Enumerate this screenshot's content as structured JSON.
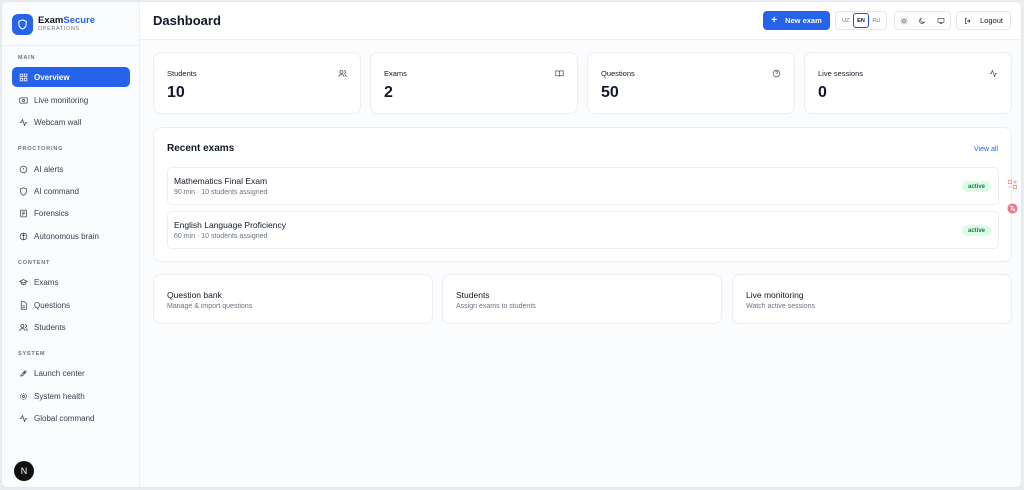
{
  "brand": {
    "name_a": "Exam",
    "name_b": "Secure",
    "subtitle": "OPERATIONS"
  },
  "sidebar": {
    "sections": [
      {
        "title": "MAIN",
        "items": [
          {
            "label": "Overview",
            "icon": "grid-icon",
            "active": true
          },
          {
            "label": "Live monitoring",
            "icon": "monitor-icon"
          },
          {
            "label": "Webcam wall",
            "icon": "activity-icon"
          }
        ]
      },
      {
        "title": "PROCTORING",
        "items": [
          {
            "label": "AI alerts",
            "icon": "alert-icon"
          },
          {
            "label": "AI command",
            "icon": "shield-icon"
          },
          {
            "label": "Forensics",
            "icon": "forensics-icon"
          },
          {
            "label": "Autonomous brain",
            "icon": "brain-icon"
          }
        ]
      },
      {
        "title": "CONTENT",
        "items": [
          {
            "label": "Exams",
            "icon": "graduation-cap-icon"
          },
          {
            "label": "Questions",
            "icon": "file-icon"
          },
          {
            "label": "Students",
            "icon": "users-icon"
          }
        ]
      },
      {
        "title": "SYSTEM",
        "items": [
          {
            "label": "Launch center",
            "icon": "rocket-icon"
          },
          {
            "label": "System health",
            "icon": "gear-icon"
          },
          {
            "label": "Global command",
            "icon": "activity-icon"
          }
        ]
      }
    ],
    "avatar_letter": "N"
  },
  "header": {
    "title": "Dashboard",
    "new_exam": "New exam",
    "languages": [
      "UZ",
      "EN",
      "RU"
    ],
    "active_language": "EN",
    "logout": "Logout"
  },
  "stats": [
    {
      "label": "Students",
      "value": "10",
      "icon": "users-icon"
    },
    {
      "label": "Exams",
      "value": "2",
      "icon": "book-icon"
    },
    {
      "label": "Questions",
      "value": "50",
      "icon": "help-circle-icon"
    },
    {
      "label": "Live sessions",
      "value": "0",
      "icon": "activity-icon"
    }
  ],
  "recent": {
    "title": "Recent exams",
    "view_all": "View all",
    "exams": [
      {
        "name": "Mathematics Final Exam",
        "meta": "90 min · 10 students assigned",
        "status": "active"
      },
      {
        "name": "English Language Proficiency",
        "meta": "60 min · 10 students assigned",
        "status": "active"
      }
    ]
  },
  "links": [
    {
      "title": "Question bank",
      "subtitle": "Manage & import questions"
    },
    {
      "title": "Students",
      "subtitle": "Assign exams to students"
    },
    {
      "title": "Live monitoring",
      "subtitle": "Watch active sessions"
    }
  ],
  "colors": {
    "accent": "#2563eb",
    "success_bg": "#dcfce7",
    "success_text": "#15803d"
  }
}
